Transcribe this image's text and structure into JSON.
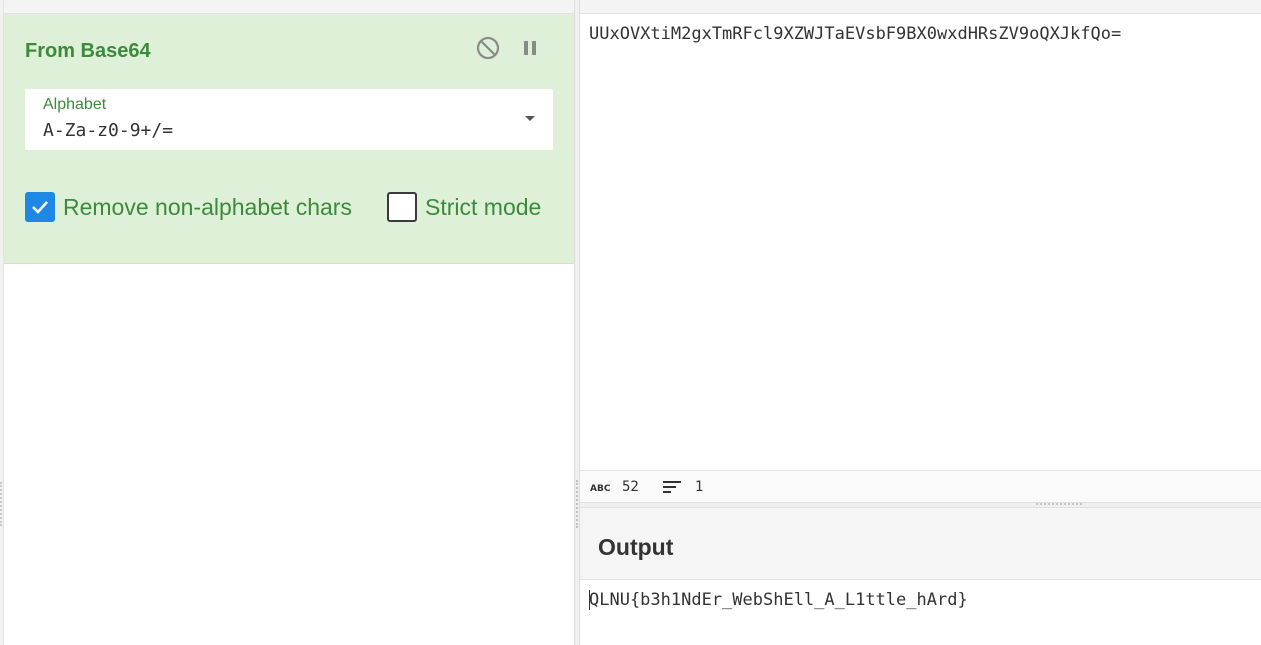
{
  "recipe": {
    "operation": {
      "title": "From Base64",
      "icons": {
        "disable": "disable-icon",
        "pause": "pause-icon"
      },
      "alphabet": {
        "label": "Alphabet",
        "value": "A-Za-z0-9+/="
      },
      "remove_non_alphabet": {
        "label": "Remove non-alphabet chars",
        "checked": true
      },
      "strict_mode": {
        "label": "Strict mode",
        "checked": false
      }
    }
  },
  "input": {
    "text": "UUxOVXtiM2gxTmRFcl9XZWJTaEVsbF9BX0wxdHRsZV9oQXJkfQo=",
    "status": {
      "length_icon": "abc-icon",
      "length": "52",
      "lines_icon": "lines-icon",
      "lines": "1"
    }
  },
  "output": {
    "title": "Output",
    "text": "QLNU{b3h1NdEr_WebShEll_A_L1ttle_hArd}"
  },
  "colors": {
    "operation_bg": "#dff0d8",
    "operation_text": "#3c8a3c",
    "checkbox_checked": "#1e88e5"
  }
}
